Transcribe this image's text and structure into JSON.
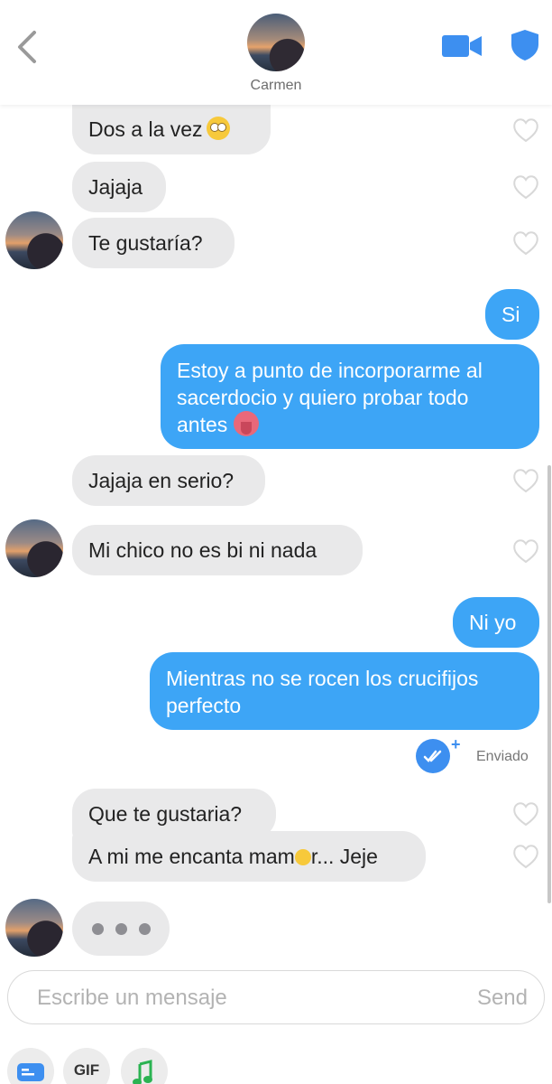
{
  "header": {
    "contact_name": "Carmen"
  },
  "messages": [
    {
      "side": "in",
      "text": "Dos a la vez"
    },
    {
      "side": "in",
      "text": "Jajaja"
    },
    {
      "side": "in",
      "text": "Te gustaría?"
    },
    {
      "side": "out",
      "text": "Si"
    },
    {
      "side": "out",
      "text": "Estoy a punto de incorporarme al sacerdocio y quiero probar todo antes"
    },
    {
      "side": "in",
      "text": "Jajaja en serio?"
    },
    {
      "side": "in",
      "text": "Mi chico no es bi ni nada"
    },
    {
      "side": "out",
      "text": "Ni yo"
    },
    {
      "side": "out",
      "text": "Mientras no se rocen los crucifijos perfecto"
    },
    {
      "side": "in",
      "text": "Que te gustaria?"
    },
    {
      "side": "in",
      "text": "A mi me encanta mam",
      "text_after": "r... Jeje"
    }
  ],
  "status": {
    "label": "Enviado"
  },
  "composer": {
    "placeholder": "Escribe un mensaje",
    "send_label": "Send"
  },
  "toolbar": {
    "gif_label": "GIF"
  },
  "icons": [
    "back-chevron-icon",
    "video-call-icon",
    "shield-icon",
    "heart-icon",
    "double-check-icon",
    "plus-icon",
    "typing-dots-icon",
    "card-icon",
    "music-note-icon"
  ],
  "colors": {
    "accent": "#3da5f6",
    "incoming": "#e9e9ea",
    "shield": "#3d8ff0"
  }
}
